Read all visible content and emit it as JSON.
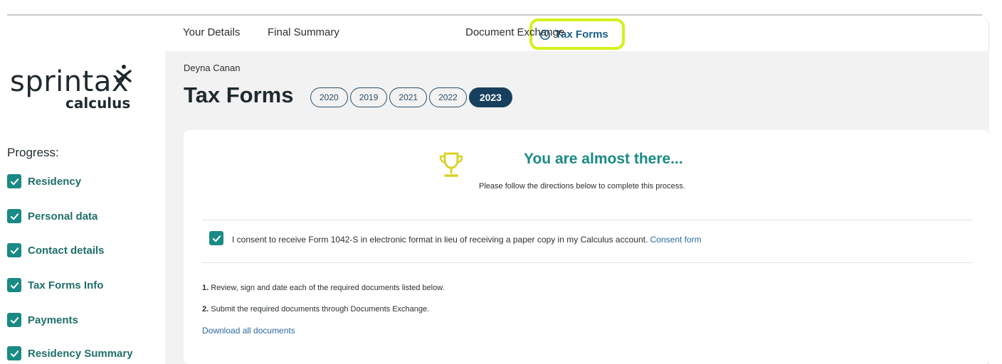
{
  "brand": {
    "logo_main": "sprintax",
    "logo_sub": "calculus",
    "accent": "#1a8a85",
    "highlight": "#d6f01c",
    "navy": "#17405e"
  },
  "nav": {
    "your_details": "Your Details",
    "final_summary": "Final Summary",
    "tax_forms": "Tax Forms",
    "document_exchange": "Document Exchange"
  },
  "progress": {
    "title": "Progress:",
    "items": [
      {
        "label": "Residency",
        "checked": true
      },
      {
        "label": "Personal data",
        "checked": true
      },
      {
        "label": "Contact details",
        "checked": true
      },
      {
        "label": "Tax Forms Info",
        "checked": true
      },
      {
        "label": "Payments",
        "checked": true
      },
      {
        "label": "Residency Summary",
        "checked": true
      }
    ]
  },
  "header": {
    "user_name": "Deyna Canan",
    "title": "Tax Forms",
    "years": [
      "2020",
      "2019",
      "2021",
      "2022",
      "2023"
    ],
    "active_year": "2023"
  },
  "card": {
    "headline": "You are almost there...",
    "subline": "Please follow the directions below to complete this process.",
    "consent_text": "I consent to receive Form 1042-S in electronic format in lieu of receiving a paper copy in my Calculus account.",
    "consent_link": "Consent form",
    "steps": [
      {
        "num": "1.",
        "text": "Review, sign and date each of the required documents listed below."
      },
      {
        "num": "2.",
        "text": "Submit the required documents through Documents Exchange."
      }
    ],
    "download_link": "Download all documents"
  }
}
